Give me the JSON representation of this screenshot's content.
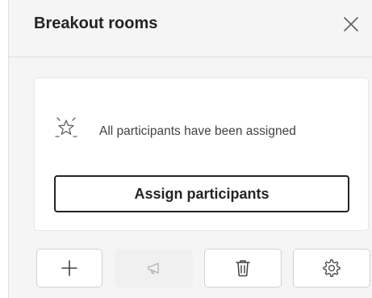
{
  "panel": {
    "title": "Breakout rooms",
    "close_icon": "close-icon"
  },
  "status": {
    "icon": "sparkle-stars-icon",
    "message": "All participants have been assigned"
  },
  "actions": {
    "assign_label": "Assign participants"
  },
  "toolbar": [
    {
      "icon": "add-icon",
      "enabled": true
    },
    {
      "icon": "announcement-megaphone-icon",
      "enabled": false
    },
    {
      "icon": "delete-trash-icon",
      "enabled": true
    },
    {
      "icon": "settings-gear-icon",
      "enabled": true
    }
  ]
}
